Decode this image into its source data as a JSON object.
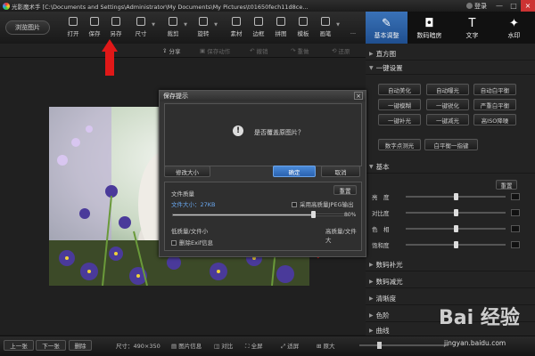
{
  "titlebar": {
    "title": "光影魔术手 [C:\\Documents and Settings\\Administrator\\My Documents\\My Pictures\\t01650fech11d8ce...",
    "login": "登录",
    "min": "—",
    "max": "□",
    "close": "×"
  },
  "toolbar": {
    "browse_label": "浏览图片",
    "tools": [
      {
        "label": "打开",
        "icon": "open-icon"
      },
      {
        "label": "保存",
        "icon": "save-icon"
      },
      {
        "label": "另存",
        "icon": "save-as-icon"
      },
      {
        "label": "尺寸",
        "icon": "resize-icon"
      },
      {
        "label": "裁剪",
        "icon": "crop-icon"
      },
      {
        "label": "旋转",
        "icon": "rotate-icon"
      },
      {
        "label": "素材",
        "icon": "material-icon"
      },
      {
        "label": "边框",
        "icon": "border-icon"
      },
      {
        "label": "拼图",
        "icon": "collage-icon"
      },
      {
        "label": "模板",
        "icon": "template-icon"
      },
      {
        "label": "画笔",
        "icon": "brush-icon"
      },
      {
        "label": "...",
        "icon": "more-icon"
      }
    ]
  },
  "right_tabs": [
    {
      "label": "基本调整",
      "icon": "adjust-icon",
      "glyph": "✎"
    },
    {
      "label": "数码暗房",
      "icon": "camera-icon",
      "glyph": "◘"
    },
    {
      "label": "文字",
      "icon": "text-icon",
      "glyph": "T"
    },
    {
      "label": "水印",
      "icon": "watermark-icon",
      "glyph": "✦"
    }
  ],
  "subbar": {
    "share": "分享",
    "save_action": "保存动作",
    "undo": "撤销",
    "redo": "重做",
    "restore": "还原"
  },
  "panel": {
    "histogram": "直方图",
    "one_click": "一键设置",
    "presets": [
      [
        "自动美化",
        "自动曝光",
        "自动白平衡"
      ],
      [
        "一键模糊",
        "一键锐化",
        "严重白平衡"
      ],
      [
        "一键补光",
        "一键减光",
        "高ISO降噪"
      ]
    ],
    "wb_buttons": [
      "数字点测光",
      "白平衡一指键"
    ],
    "basic": "基本",
    "reset": "重置",
    "sliders": [
      {
        "label": "亮　度",
        "value": 0.5
      },
      {
        "label": "对比度",
        "value": 0.5
      },
      {
        "label": "色　相",
        "value": 0.5
      },
      {
        "label": "饱和度",
        "value": 0.5
      }
    ],
    "sections": [
      "数码补光",
      "数码减光",
      "清晰度",
      "色阶",
      "曲线"
    ]
  },
  "dialog": {
    "title": "保存提示",
    "close": "×",
    "question": "是否覆盖原图片？",
    "q_icon": "!",
    "resize_btn": "修改大小",
    "ok_btn": "确定",
    "cancel_btn": "取消",
    "quality_title": "文件质量",
    "reset_btn": "重置",
    "file_size": "文件大小：27KB",
    "hq_option": "采用高质量JPEG输出",
    "quality_value": 0.8,
    "quality_text": "80%",
    "low_label": "低质量/文件小",
    "high_label": "高质量/文件大",
    "exif_option": "删除Exif信息"
  },
  "statusbar": {
    "prev": "上一张",
    "next": "下一张",
    "delete": "删除",
    "size": "尺寸：490×350",
    "info": "图片信息",
    "compare": "对比",
    "full": "全屏",
    "fit": "适屏",
    "original": "原大",
    "zoom": 0.2
  },
  "watermark": {
    "brand": "Bai 经验",
    "url": "jingyan.baidu.com"
  },
  "colors": {
    "accent": "#2f64ae",
    "annotation_red": "#e01818"
  }
}
